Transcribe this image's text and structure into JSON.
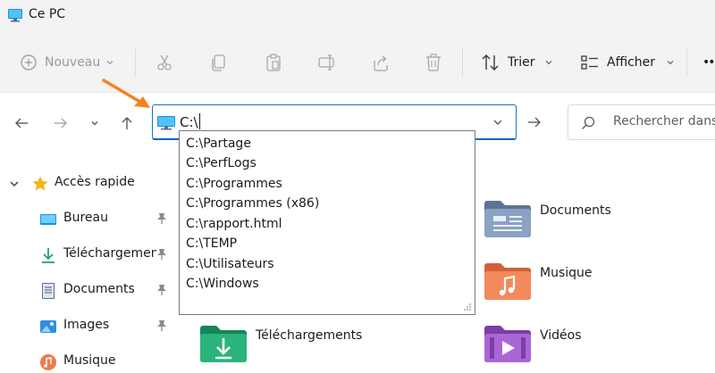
{
  "window": {
    "title": "Ce PC"
  },
  "commandbar": {
    "new_label": "Nouveau",
    "sort_label": "Trier",
    "view_label": "Afficher",
    "more_label": "••"
  },
  "address": {
    "value": "C:\\",
    "suggestions": [
      "C:\\Partage",
      "C:\\PerfLogs",
      "C:\\Programmes",
      "C:\\Programmes (x86)",
      "C:\\rapport.html",
      "C:\\TEMP",
      "C:\\Utilisateurs",
      "C:\\Windows"
    ]
  },
  "search": {
    "placeholder": "Rechercher dans s"
  },
  "navpane": {
    "quick_access_label": "Accès rapide",
    "items": [
      {
        "label": "Bureau",
        "icon": "desktop-icon"
      },
      {
        "label": "Téléchargements",
        "icon": "download-icon"
      },
      {
        "label": "Documents",
        "icon": "documents-icon"
      },
      {
        "label": "Images",
        "icon": "images-icon"
      },
      {
        "label": "Musique",
        "icon": "music-icon"
      }
    ]
  },
  "content": {
    "folders": [
      {
        "label": "Documents",
        "icon": "documents-folder-icon"
      },
      {
        "label": "Musique",
        "icon": "music-folder-icon"
      },
      {
        "label": "Téléchargements",
        "icon": "downloads-folder-icon"
      },
      {
        "label": "Vidéos",
        "icon": "videos-folder-icon"
      }
    ]
  },
  "colors": {
    "accent": "#0067c0",
    "annotation_arrow": "#f58220",
    "folder_yellow": "#f8c43c"
  }
}
